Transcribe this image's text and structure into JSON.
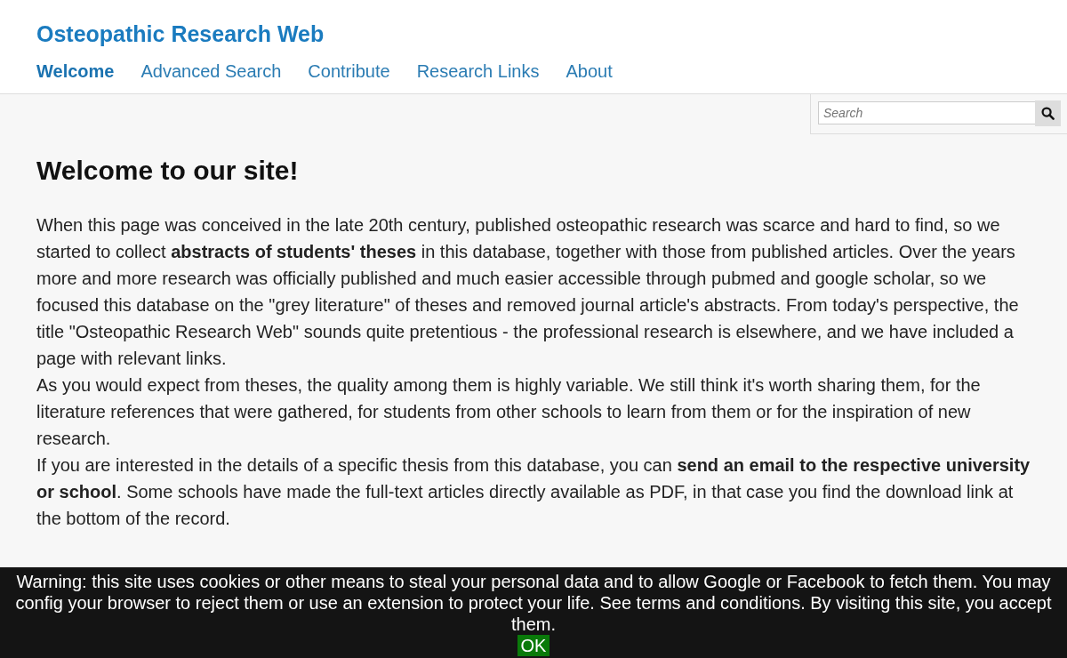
{
  "site_title": "Osteopathic Research Web",
  "nav": [
    {
      "label": "Welcome",
      "selected": true
    },
    {
      "label": "Advanced Search",
      "selected": false
    },
    {
      "label": "Contribute",
      "selected": false
    },
    {
      "label": "Research Links",
      "selected": false
    },
    {
      "label": "About",
      "selected": false
    }
  ],
  "search": {
    "placeholder": "Search"
  },
  "heading": "Welcome to our site!",
  "paragraphs": [
    "When this page was conceived in the late 20th century, published osteopathic research was scarce and hard to find, so we started to collect **abstracts of students' theses** in this database, together with those from published articles. Over the years more and more research was officially published and much easier accessible through pubmed and google scholar, so we focused this database on the \"grey literature\" of theses and removed journal article's abstracts. From today's perspective, the title \"Osteopathic Research Web\" sounds quite pretentious - the professional research is elsewhere, and we have included a page with relevant links.",
    "As you would expect from theses, the quality among them is highly variable. We still think it's worth sharing them, for the literature references that were gathered, for students from other schools to learn from them or for the inspiration of new research.",
    "If you are interested in the details of a specific thesis from this database, you can **send an email to the respective university or school**. Some schools have made the full-text articles directly available as PDF, in that case you find the download link at the bottom of the record."
  ],
  "cookie_banner": {
    "text": "Warning: this site uses cookies or other means to steal your personal data and to allow Google or Facebook to fetch them. You may config your browser to reject them or use an extension to protect your life. See terms and conditions. By visiting this site, you accept them.",
    "button": "OK"
  }
}
